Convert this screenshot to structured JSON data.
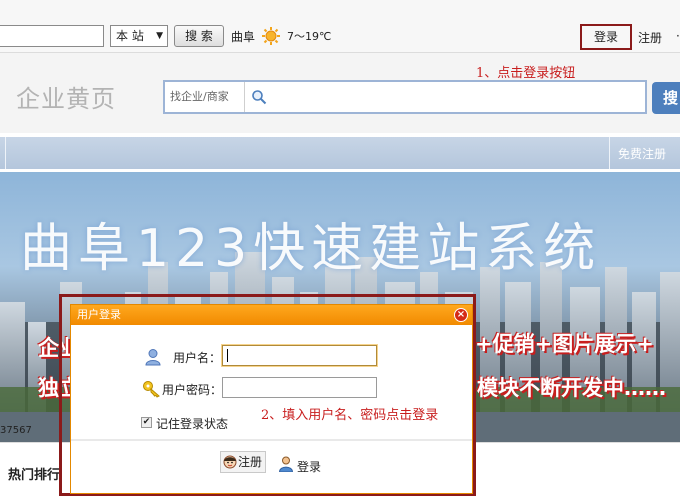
{
  "topbar": {
    "site_scope": "本 站",
    "search_button": "搜 索",
    "city": "曲阜",
    "temperature": "7～19℃",
    "login": "登录",
    "register": "注册",
    "more": "·"
  },
  "header": {
    "logo": "企业黄页",
    "annotation": "1、点击登录按钮",
    "search_scope": "找企业/商家",
    "search_button": "搜"
  },
  "nav": {
    "free_register": "免费注册"
  },
  "banner": {
    "title": "曲阜123快速建站系统",
    "line1_left": "企业",
    "line1_right": "+促销+图片展示+",
    "line2_left": "独立",
    "line2_right": "模块不断开发中……",
    "code": "37567"
  },
  "section": {
    "hot_title": "热门排行"
  },
  "dialog": {
    "title": "用户登录",
    "close": "×",
    "username_label": "用户名：",
    "password_label": "用户密码：",
    "remember": "记住登录状态",
    "annotation": "2、填入用户名、密码点击登录",
    "register_button": "注册",
    "login_button": "登录"
  }
}
